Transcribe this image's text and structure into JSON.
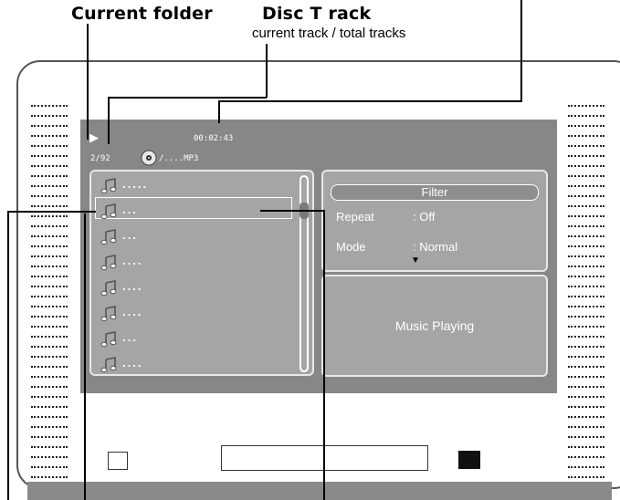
{
  "callouts": {
    "current_folder": "Current folder",
    "disc_track": "Disc T rack",
    "disc_track_sub": "current track / total tracks"
  },
  "osd": {
    "play_symbol": "▶",
    "time": "00:02:43",
    "track_counter": "2/92",
    "disc_path": "/....MP3"
  },
  "playlist": {
    "items": [
      {
        "label": "....."
      },
      {
        "label": "..."
      },
      {
        "label": "..."
      },
      {
        "label": "...."
      },
      {
        "label": "...."
      },
      {
        "label": "...."
      },
      {
        "label": "..."
      },
      {
        "label": "...."
      }
    ],
    "selected_index": 1
  },
  "filter_panel": {
    "title": "Filter",
    "repeat_label": "Repeat",
    "repeat_value": ": Off",
    "mode_label": "Mode",
    "mode_value": ": Normal",
    "more_indicator": "▼"
  },
  "status_panel": {
    "text": "Music Playing"
  },
  "icons": {
    "track": "music-note-icon",
    "disc": "disc-icon",
    "play": "play-icon"
  }
}
